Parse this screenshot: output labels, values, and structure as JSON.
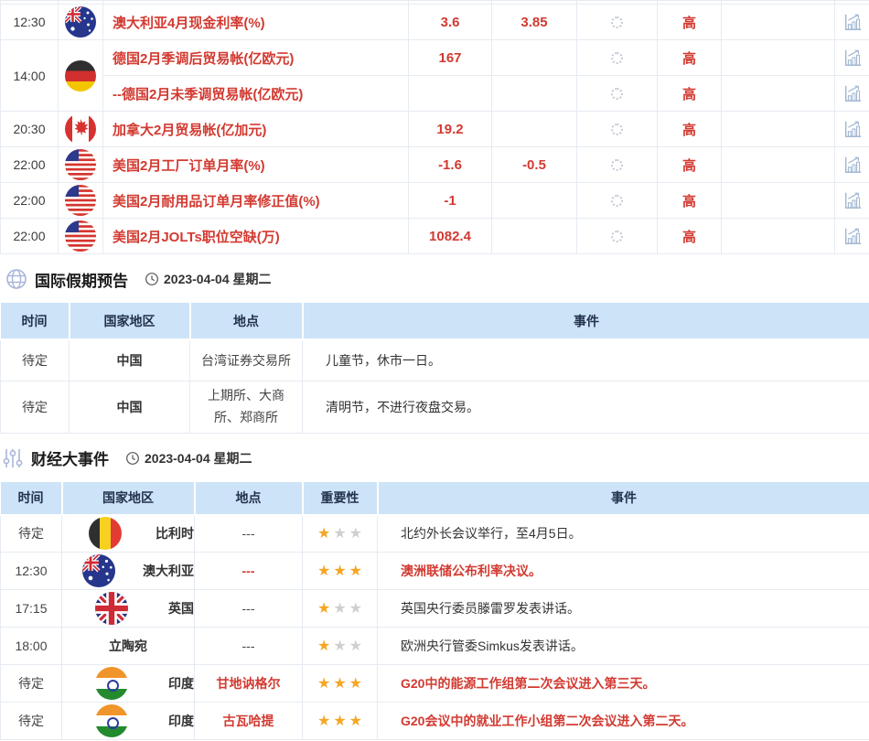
{
  "colors": {
    "accent_red": "#d23a31",
    "table_header_bg": "#cde3f7",
    "table_header_text": "#22324d",
    "star_filled": "#f6a623",
    "star_empty": "#cfcfcf",
    "chart_icon": "#a2b8d2",
    "border": "#e6ebf2"
  },
  "icons": {
    "globe-icon": "wireframe globe",
    "sliders-icon": "vertical slider controls",
    "clock-icon": "clock outline",
    "chart-icon": "bar chart with rising arrow",
    "loading-spinner-icon": "dotted loading circle",
    "flag-australia-icon": "Australia flag roundel",
    "flag-germany-icon": "Germany flag roundel",
    "flag-canada-icon": "Canada flag roundel",
    "flag-usa-icon": "USA flag roundel",
    "flag-belgium-icon": "Belgium flag roundel",
    "flag-uk-icon": "United Kingdom flag roundel",
    "flag-india-icon": "India flag roundel"
  },
  "economic_table": {
    "rows": [
      {
        "time": "12:30",
        "flag": "australia",
        "event": "澳大利亚4月现金利率(%)",
        "actual": "3.6",
        "forecast": "3.85",
        "importance": "高"
      },
      {
        "time": "14:00",
        "flag": "germany",
        "event": "德国2月季调后贸易帐(亿欧元)",
        "actual": "167",
        "forecast": "",
        "importance": "高"
      },
      {
        "time": "",
        "flag": "germany",
        "event": "--德国2月未季调贸易帐(亿欧元)",
        "actual": "",
        "forecast": "",
        "importance": "高"
      },
      {
        "time": "20:30",
        "flag": "canada",
        "event": "加拿大2月贸易帐(亿加元)",
        "actual": "19.2",
        "forecast": "",
        "importance": "高"
      },
      {
        "time": "22:00",
        "flag": "usa",
        "event": "美国2月工厂订单月率(%)",
        "actual": "-1.6",
        "forecast": "-0.5",
        "importance": "高"
      },
      {
        "time": "22:00",
        "flag": "usa",
        "event": "美国2月耐用品订单月率修正值(%)",
        "actual": "-1",
        "forecast": "",
        "importance": "高"
      },
      {
        "time": "22:00",
        "flag": "usa",
        "event": "美国2月JOLTs职位空缺(万)",
        "actual": "1082.4",
        "forecast": "",
        "importance": "高"
      }
    ]
  },
  "holiday_section": {
    "title": "国际假期预告",
    "date": "2023-04-04 星期二",
    "columns": [
      "时间",
      "国家地区",
      "地点",
      "事件"
    ],
    "rows": [
      {
        "time": "待定",
        "country": "中国",
        "place": "台湾证券交易所",
        "event": "儿童节，休市一日。"
      },
      {
        "time": "待定",
        "country": "中国",
        "place": "上期所、大商所、郑商所",
        "event": "清明节，不进行夜盘交易。"
      }
    ]
  },
  "events_section": {
    "title": "财经大事件",
    "date": "2023-04-04 星期二",
    "columns": [
      "时间",
      "国家地区",
      "地点",
      "重要性",
      "事件"
    ],
    "rows": [
      {
        "time": "待定",
        "flag": "belgium",
        "country": "比利时",
        "place": "---",
        "stars": 1,
        "event": "北约外长会议举行，至4月5日。",
        "highlight": false
      },
      {
        "time": "12:30",
        "flag": "australia",
        "country": "澳大利亚",
        "place": "---",
        "stars": 3,
        "event": "澳洲联储公布利率决议。",
        "highlight": true
      },
      {
        "time": "17:15",
        "flag": "uk",
        "country": "英国",
        "place": "---",
        "stars": 1,
        "event": "英国央行委员滕雷罗发表讲话。",
        "highlight": false
      },
      {
        "time": "18:00",
        "flag": "",
        "country": "立陶宛",
        "place": "---",
        "stars": 1,
        "event": "欧洲央行管委Simkus发表讲话。",
        "highlight": false
      },
      {
        "time": "待定",
        "flag": "india",
        "country": "印度",
        "place": "甘地讷格尔",
        "stars": 3,
        "event": "G20中的能源工作组第二次会议进入第三天。",
        "highlight": true
      },
      {
        "time": "待定",
        "flag": "india",
        "country": "印度",
        "place": "古瓦哈提",
        "stars": 3,
        "event": "G20会议中的就业工作小组第二次会议进入第二天。",
        "highlight": true
      }
    ]
  }
}
